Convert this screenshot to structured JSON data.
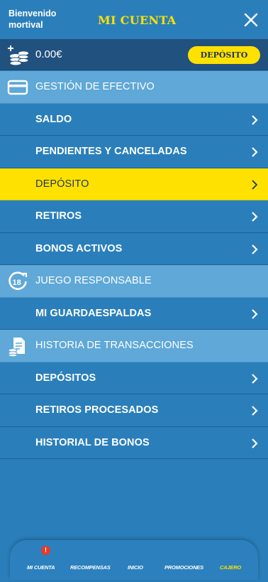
{
  "header": {
    "welcome": "Bienvenido mortival",
    "title": "MI CUENTA"
  },
  "balance": {
    "amount": "0.00€",
    "deposit_label": "DEPÓSITO"
  },
  "menu": {
    "cash_section": "GESTIÓN DE EFECTIVO",
    "saldo": "SALDO",
    "pending": "PENDIENTES Y CANCELADAS",
    "deposit": "DEPÓSITO",
    "withdrawals": "RETIROS",
    "active_bonuses": "BONOS ACTIVOS",
    "responsible_section": "JUEGO RESPONSABLE",
    "bodyguard": "MI GUARDAESPALDAS",
    "history_section": "HISTORIA DE TRANSACCIONES",
    "deposits": "DEPÓSITOS",
    "processed_withdrawals": "RETIROS PROCESADOS",
    "bonus_history": "HISTORIAL DE BONOS"
  },
  "bottom_nav": {
    "account": "MI CUENTA",
    "rewards": "RECOMPENSAS",
    "home": "INICIO",
    "promotions": "PROMOCIONES",
    "cashier": "CAJERO",
    "alert_badge": "!"
  },
  "colors": {
    "background": "#2a7fbb",
    "section": "#5fa8d8",
    "accent_yellow": "#ffe100",
    "balance_bar": "#21517e"
  },
  "icons": [
    "coins-plus-icon",
    "credit-card-icon",
    "age-18-icon",
    "document-coins-icon",
    "close-icon",
    "chevron-right-icon"
  ]
}
